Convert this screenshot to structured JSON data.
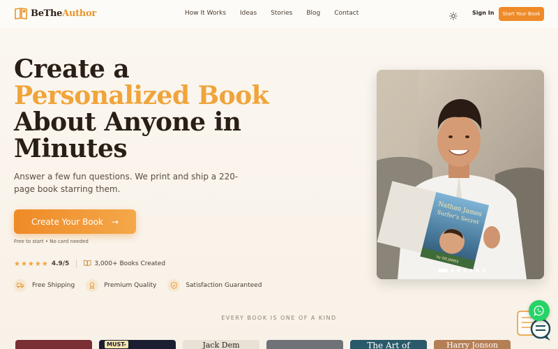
{
  "brand": {
    "part1": "BeThe",
    "part2": "Author"
  },
  "nav": {
    "links": [
      "How It Works",
      "Ideas",
      "Stories",
      "Blog",
      "Contact"
    ],
    "signin": "Sign In",
    "start": "Start Your Book"
  },
  "hero": {
    "line1": "Create a",
    "accent": "Personalized Book",
    "line2": "About Anyone in",
    "line3": "Minutes",
    "subtext": "Answer a few fun questions. We print and ship a 220-page book starring them.",
    "cta": "Create Your Book",
    "cta_arrow": "→",
    "cta_note": "Free to start • No card needed",
    "rating": "4.9/5",
    "books_created": "3,000+ Books Created",
    "features": [
      "Free Shipping",
      "Premium Quality",
      "Satisfaction Guaranteed"
    ]
  },
  "photo": {
    "book_title_1": "Nathan James",
    "book_title_2": "Surfer's Secret",
    "book_author": "by ON JAMES",
    "carousel_total": 7,
    "carousel_active": 1
  },
  "showcase": {
    "kicker": "EVERY BOOK IS ONE OF A KIND",
    "books": [
      {
        "title": "",
        "color": "#7a2f34"
      },
      {
        "title": "MUST-",
        "color": "#1b1d30"
      },
      {
        "title": "Jack Dem",
        "color": "#2b2f3a"
      },
      {
        "title": "",
        "color": "#6f7378"
      },
      {
        "title": "The Art of",
        "color": "#2a5a6a"
      },
      {
        "title": "Harry Jonson",
        "color": "#b57f56"
      }
    ]
  },
  "colors": {
    "accent": "#ef8a28",
    "gold": "#f0a43a",
    "whatsapp": "#25d366"
  }
}
